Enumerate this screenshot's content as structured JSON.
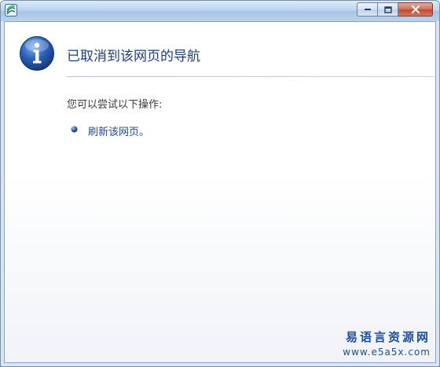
{
  "window": {
    "minimize_glyph": "▬",
    "maximize_glyph": "□",
    "close_glyph": "✕"
  },
  "page": {
    "heading": "已取消到该网页的导航",
    "subtext": "您可以尝试以下操作:",
    "actions": [
      {
        "label": "刷新该网页。"
      }
    ]
  },
  "watermark": {
    "line1": "易语言资源网",
    "line2": "www.e5a5x.com"
  },
  "colors": {
    "heading": "#1f3f75",
    "link": "#1e4a9b",
    "info_icon": "#2a5fb8"
  },
  "icons": [
    "app-icon",
    "info-icon",
    "bullet-icon"
  ]
}
